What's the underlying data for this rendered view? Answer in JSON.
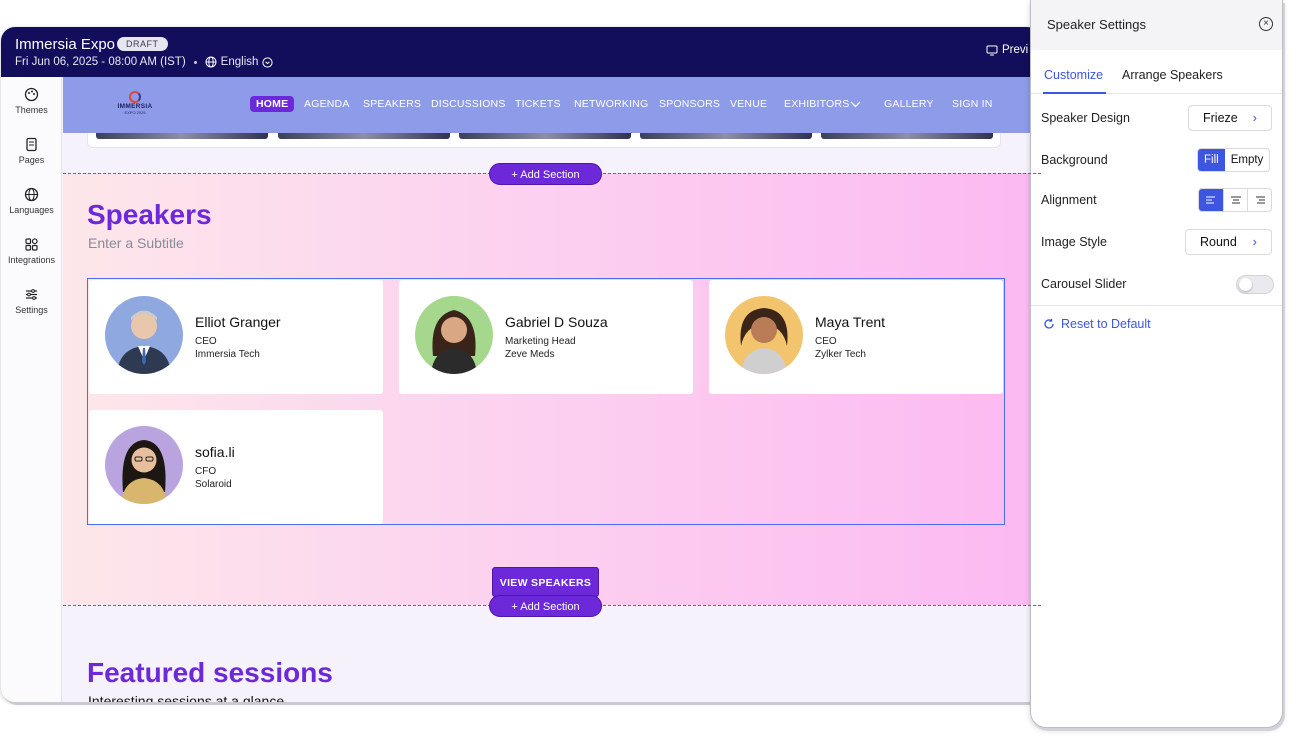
{
  "topbar": {
    "event_title": "Immersia Expo",
    "status_badge": "DRAFT",
    "datetime": "Fri Jun 06, 2025 - 08:00 AM (IST)",
    "language": "English",
    "preview_label": "Previ"
  },
  "sidebar": {
    "items": [
      {
        "label": "Themes",
        "icon": "palette-icon"
      },
      {
        "label": "Pages",
        "icon": "pages-icon"
      },
      {
        "label": "Languages",
        "icon": "globe-icon"
      },
      {
        "label": "Integrations",
        "icon": "integrations-icon"
      },
      {
        "label": "Settings",
        "icon": "sliders-icon"
      }
    ]
  },
  "site_nav": {
    "logo_text": "IMMERSIA",
    "logo_sub": "EXPO 2025",
    "items": [
      "HOME",
      "AGENDA",
      "SPEAKERS",
      "DISCUSSIONS",
      "TICKETS",
      "NETWORKING",
      "SPONSORS",
      "VENUE",
      "EXHIBITORS",
      "GALLERY",
      "SIGN IN"
    ]
  },
  "add_section_label": "+ Add Section",
  "speakers_section": {
    "title": "Speakers",
    "subtitle": "Enter a Subtitle",
    "speakers": [
      {
        "name": "Elliot Granger",
        "role": "CEO",
        "company": "Immersia Tech",
        "avatar_bg": "#8fa8e0"
      },
      {
        "name": "Gabriel D Souza",
        "role": "Marketing Head",
        "company": "Zeve Meds",
        "avatar_bg": "#a5d88c"
      },
      {
        "name": "Maya Trent",
        "role": "CEO",
        "company": "Zylker Tech",
        "avatar_bg": "#f2c46d"
      },
      {
        "name": "sofia.li",
        "role": "CFO",
        "company": "Solaroid",
        "avatar_bg": "#b9a4e0"
      }
    ],
    "view_button": "VIEW SPEAKERS"
  },
  "featured_section": {
    "title": "Featured sessions",
    "subtitle": "Interesting sessions at a glance"
  },
  "settings_panel": {
    "title": "Speaker Settings",
    "tabs": [
      "Customize",
      "Arrange Speakers"
    ],
    "active_tab": "Customize",
    "speaker_design": {
      "label": "Speaker Design",
      "value": "Frieze"
    },
    "background": {
      "label": "Background",
      "options": [
        "Fill",
        "Empty"
      ],
      "selected": "Fill"
    },
    "alignment": {
      "label": "Alignment",
      "options": [
        "left",
        "center",
        "right"
      ],
      "selected": "left"
    },
    "image_style": {
      "label": "Image Style",
      "value": "Round"
    },
    "carousel_slider": {
      "label": "Carousel Slider",
      "enabled": false
    },
    "reset_label": "Reset to Default"
  },
  "colors": {
    "topbar": "#120e5b",
    "nav": "#8e9be8",
    "brand_purple": "#6c28d9",
    "accent_blue": "#3d55e0"
  }
}
